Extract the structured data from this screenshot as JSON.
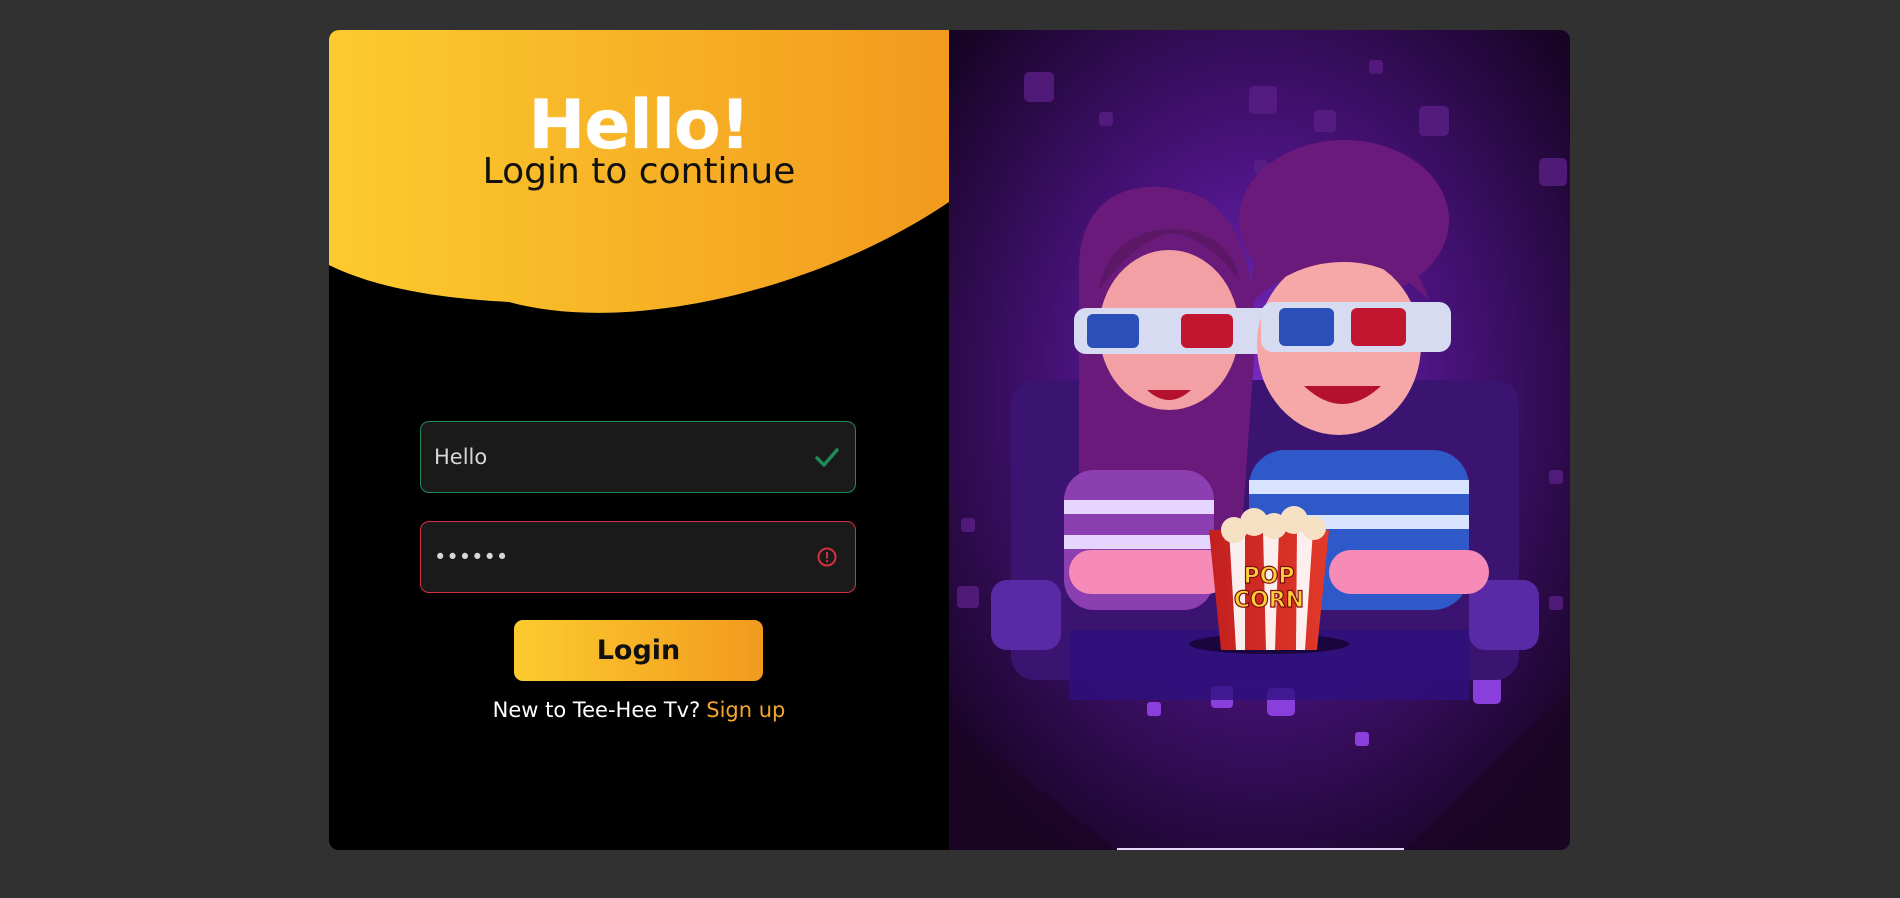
{
  "header": {
    "greeting": "Hello!",
    "subtitle": "Login to continue"
  },
  "form": {
    "username": {
      "value": "Hello",
      "status": "valid",
      "status_icon": "check-icon"
    },
    "password": {
      "value": "••••••",
      "status": "error",
      "status_icon": "error-icon"
    },
    "login_label": "Login",
    "signup_prompt": "New to Tee-Hee Tv?",
    "signup_link": "Sign up"
  },
  "illustration": {
    "popcorn_top": "POP",
    "popcorn_bottom": "CORN"
  },
  "colors": {
    "page_bg": "#313131",
    "accent_start": "#fccb2e",
    "accent_end": "#f29a1e",
    "valid": "#1f8a55",
    "error": "#d33040",
    "link": "#f3a62a",
    "scene_bg": "#2a0a3d"
  }
}
